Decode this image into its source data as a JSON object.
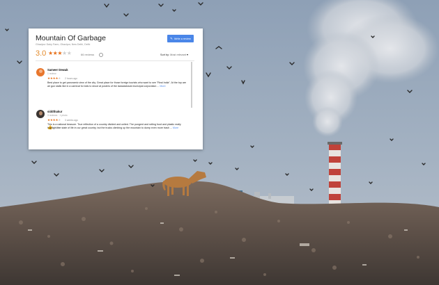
{
  "place": {
    "title": "Mountain Of Garbage",
    "subtitle": "Ghazipur Dairy Farm, Ghazipur, New Delhi, Delhi",
    "rating_value": "3.0",
    "rating_stars": 3,
    "reviews_count": "66 reviews",
    "write_review_label": "Write a review",
    "sort_label": "Sort by:",
    "sort_value": "Most relevant"
  },
  "reviews": [
    {
      "name": "Sameer Dewak",
      "meta": "1 review",
      "stars": 4,
      "time": "2 hours ago",
      "text": "Best place to get panoramic view of the city. Great place for those foreign tourists who want to see \"Real India\". At the top are air gun stalls like in a carnival for kids to shoot at posters of the lackadaisical municipal corporation ...",
      "more": "More",
      "like_label": "Like"
    },
    {
      "name": "siddthakur",
      "meta": "3 reviews · 1 photo",
      "stars": 4,
      "time": "3 weeks ago",
      "text": "This is a national treasure. True reflection of a country divided and united. The pungent and rotting food and plastic really highlight the state of life in our great country, but the trucks climbing up the mountain to dump even more trash ...",
      "more": "More",
      "like_count": "3"
    }
  ],
  "colors": {
    "accent_blue": "#4a86e8",
    "rating_orange": "#e38b2c",
    "star_orange": "#e7711b"
  },
  "icons": [
    "pencil-icon",
    "star-icon",
    "info-icon",
    "chevron-down-icon",
    "thumbs-up-icon",
    "dog",
    "smokestack",
    "birds"
  ]
}
